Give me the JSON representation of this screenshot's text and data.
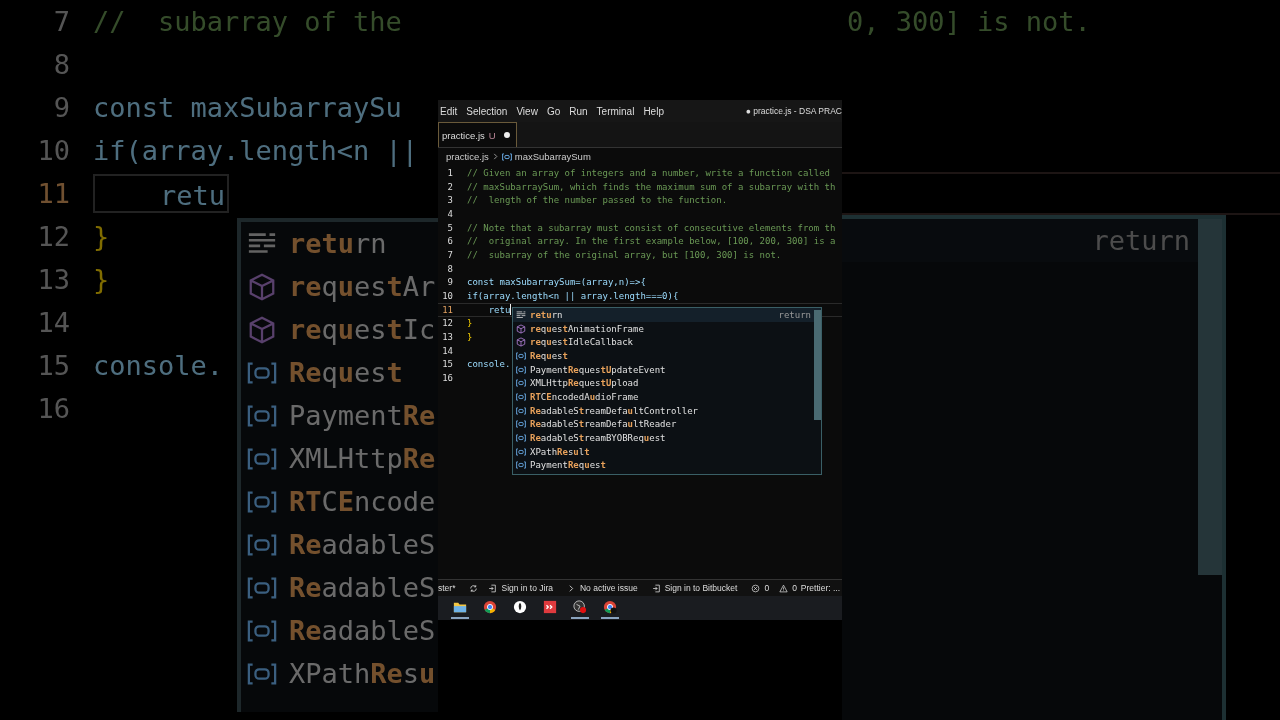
{
  "backdrop": {
    "left_lines": [
      {
        "number": "7",
        "kind": "comment",
        "text": "//  subarray of the",
        "current": false
      },
      {
        "number": "8",
        "current": false
      },
      {
        "number": "9",
        "kind": "code",
        "text": "const maxSubarraySu",
        "current": false
      },
      {
        "number": "10",
        "kind": "code",
        "text": "if(array.length<n ||",
        "current": false
      },
      {
        "number": "11",
        "kind": "code",
        "text": "    retu",
        "current": true
      },
      {
        "number": "12",
        "kind": "brace",
        "text": "}",
        "current": false
      },
      {
        "number": "13",
        "kind": "brace",
        "text": "}",
        "current": false
      },
      {
        "number": "14",
        "current": false
      },
      {
        "number": "15",
        "kind": "code",
        "text": "console.",
        "current": false
      },
      {
        "number": "16",
        "current": false
      }
    ],
    "left_suggestions": [
      {
        "kind": "keyword",
        "label": "**retu**rn"
      },
      {
        "kind": "method",
        "label": "**re**q**u**es**t**Ar"
      },
      {
        "kind": "method",
        "label": "**re**q**u**es**t**Ic"
      },
      {
        "kind": "variable",
        "label": "**Re**q**u**es**t**"
      },
      {
        "kind": "variable",
        "label": "Payment**Re**"
      },
      {
        "kind": "variable",
        "label": "XMLHttp**Re**"
      },
      {
        "kind": "variable",
        "label": "**RT**C**E**ncode"
      },
      {
        "kind": "variable",
        "label": "**Re**adableS"
      },
      {
        "kind": "variable",
        "label": "**Re**adableS"
      },
      {
        "kind": "variable",
        "label": "**Re**adableS"
      },
      {
        "kind": "variable",
        "label": "XPath**Re**s**u**"
      }
    ],
    "right_text": "0, 300] is not.",
    "right_detail": "return"
  },
  "window": {
    "menu": [
      "Edit",
      "Selection",
      "View",
      "Go",
      "Run",
      "Terminal",
      "Help"
    ],
    "title": "● practice.js - DSA PRAC"
  },
  "tabs": [
    {
      "label": "practice.js",
      "status": "U",
      "modified": true,
      "selected": true
    }
  ],
  "breadcrumb": {
    "file": "practice.js",
    "symbol": "maxSubarraySum"
  },
  "editor": {
    "lines": [
      {
        "number": "1",
        "kind": "comment",
        "text": "// Given an array of integers and a number, write a function called",
        "current": false
      },
      {
        "number": "2",
        "kind": "comment",
        "text": "// maxSubarraySum, which finds the maximum sum of a subarray with th",
        "current": false
      },
      {
        "number": "3",
        "kind": "comment",
        "text": "//  length of the number passed to the function.",
        "current": false
      },
      {
        "number": "4",
        "current": false
      },
      {
        "number": "5",
        "kind": "comment",
        "text": "// Note that a subarray must consist of consecutive elements from th",
        "current": false
      },
      {
        "number": "6",
        "kind": "comment",
        "text": "//  original array. In the first example below, [100, 200, 300] is a",
        "current": false
      },
      {
        "number": "7",
        "kind": "comment",
        "text": "//  subarray of the original array, but [100, 300] is not.",
        "current": false
      },
      {
        "number": "8",
        "current": false
      },
      {
        "number": "9",
        "kind": "code",
        "text": "const maxSubarraySum=(array,n)=>{",
        "current": false
      },
      {
        "number": "10",
        "kind": "code",
        "text": "if(array.length<n || array.length===0){",
        "current": false
      },
      {
        "number": "11",
        "kind": "code",
        "text": "    retu",
        "current": true
      },
      {
        "number": "12",
        "kind": "brace",
        "text": "}",
        "current": false
      },
      {
        "number": "13",
        "kind": "brace",
        "text": "}",
        "current": false
      },
      {
        "number": "14",
        "current": false
      },
      {
        "number": "15",
        "kind": "code",
        "text": "console.",
        "current": false
      },
      {
        "number": "16",
        "current": false
      }
    ],
    "suggestions": [
      {
        "kind": "keyword",
        "label": "**retu**rn",
        "detail": "return",
        "selected": true
      },
      {
        "kind": "method",
        "label": "**re**q**u**es**t**AnimationFrame",
        "selected": false
      },
      {
        "kind": "method",
        "label": "**re**q**u**es**t**IdleCallback",
        "selected": false
      },
      {
        "kind": "variable",
        "label": "**Re**q**u**es**t**",
        "selected": false
      },
      {
        "kind": "variable",
        "label": "Payment**Re**ques**tU**pdateEvent",
        "selected": false
      },
      {
        "kind": "variable",
        "label": "XMLHttp**Re**ques**tU**pload",
        "selected": false
      },
      {
        "kind": "variable",
        "label": "**RT**C**E**ncodedA**u**dioFrame",
        "selected": false
      },
      {
        "kind": "variable",
        "label": "**Re**adableS**t**reamDefa**u**ltController",
        "selected": false
      },
      {
        "kind": "variable",
        "label": "**Re**adableS**t**reamDefa**u**ltReader",
        "selected": false
      },
      {
        "kind": "variable",
        "label": "**Re**adableS**t**reamBYOBReq**u**est",
        "selected": false
      },
      {
        "kind": "variable",
        "label": "XPath**Re**s**u**l**t**",
        "selected": false
      },
      {
        "kind": "variable",
        "label": "Payment**Re**q**u**es**t**",
        "selected": false
      }
    ]
  },
  "status_bar": [
    {
      "kind": "branch",
      "text": "ster*"
    },
    {
      "kind": "sync"
    },
    {
      "kind": "signin",
      "text": "Sign in to Jira"
    },
    {
      "kind": "issue",
      "text": "No active issue"
    },
    {
      "kind": "signin",
      "text": "Sign in to Bitbucket"
    },
    {
      "kind": "error",
      "text": "0"
    },
    {
      "kind": "warning",
      "text": "0"
    },
    {
      "kind": "formatter",
      "text": "Prettier: ..."
    }
  ],
  "taskbar": [
    {
      "kind": "folder",
      "active": true
    },
    {
      "kind": "chrome",
      "active": false
    },
    {
      "kind": "leaf",
      "active": false
    },
    {
      "kind": "red-app",
      "active": false
    },
    {
      "kind": "recorder",
      "active": true
    },
    {
      "kind": "chrome-profile",
      "active": true
    }
  ]
}
